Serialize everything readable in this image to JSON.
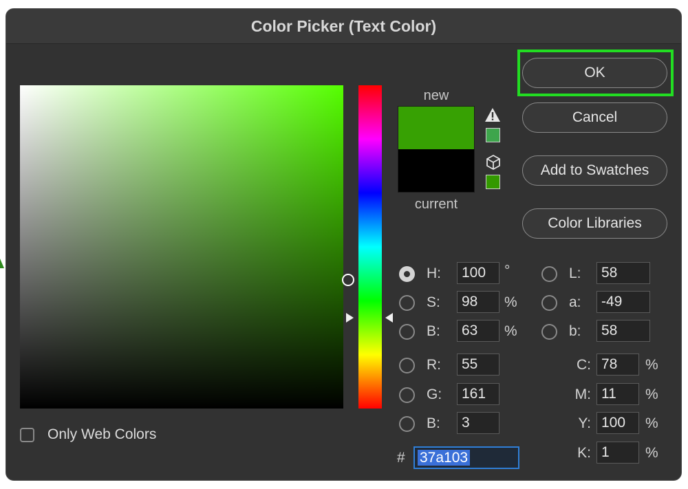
{
  "window": {
    "title": "Color Picker (Text Color)"
  },
  "preview": {
    "new_label": "new",
    "current_label": "current",
    "new_color": "#37a103",
    "current_color": "#000000"
  },
  "buttons": {
    "ok": "OK",
    "cancel": "Cancel",
    "add_swatches": "Add to Swatches",
    "libraries": "Color Libraries"
  },
  "hsb": {
    "h": {
      "label": "H:",
      "value": "100",
      "unit": "°"
    },
    "s": {
      "label": "S:",
      "value": "98",
      "unit": "%"
    },
    "b": {
      "label": "B:",
      "value": "63",
      "unit": "%"
    }
  },
  "rgb": {
    "r": {
      "label": "R:",
      "value": "55"
    },
    "g": {
      "label": "G:",
      "value": "161"
    },
    "b": {
      "label": "B:",
      "value": "3"
    }
  },
  "lab": {
    "l": {
      "label": "L:",
      "value": "58"
    },
    "a": {
      "label": "a:",
      "value": "-49"
    },
    "b": {
      "label": "b:",
      "value": "58"
    }
  },
  "cmyk": {
    "c": {
      "label": "C:",
      "value": "78",
      "unit": "%"
    },
    "m": {
      "label": "M:",
      "value": "11",
      "unit": "%"
    },
    "y": {
      "label": "Y:",
      "value": "100",
      "unit": "%"
    },
    "k": {
      "label": "K:",
      "value": "1",
      "unit": "%"
    }
  },
  "hex": {
    "prefix": "#",
    "value": "37a103"
  },
  "web_colors": {
    "label": "Only Web Colors",
    "checked": false
  },
  "selected_mode": "H",
  "icons": {
    "gamut_warning": "warning-triangle-icon",
    "web_safe": "cube-icon"
  }
}
